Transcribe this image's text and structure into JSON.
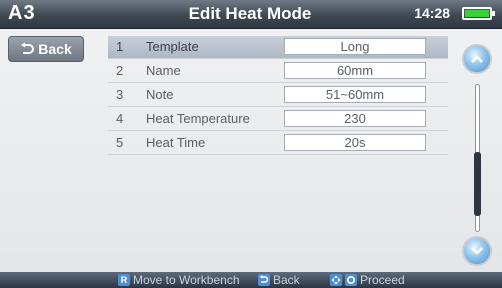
{
  "header": {
    "brand": "A3",
    "title": "Edit Heat Mode",
    "time": "14:28",
    "battery_level": 1.0
  },
  "sidebar": {
    "back_label": "Back"
  },
  "rows": [
    {
      "num": "1",
      "label": "Template",
      "value": "Long",
      "selected": true
    },
    {
      "num": "2",
      "label": "Name",
      "value": "60mm"
    },
    {
      "num": "3",
      "label": "Note",
      "value": "51~60mm"
    },
    {
      "num": "4",
      "label": "Heat Temperature",
      "value": "230"
    },
    {
      "num": "5",
      "label": "Heat Time",
      "value": "20s"
    }
  ],
  "scroll": {
    "position": 0.6
  },
  "footer": {
    "hint_move": "Move to Workbench",
    "hint_back": "Back",
    "hint_proceed": "Proceed"
  },
  "colors": {
    "header": "#3f4853",
    "selected_row": "#aeb8c5",
    "battery": "#35d23a",
    "scroll_button": "#4e90c8",
    "footer_key": "#4f8fd0"
  },
  "icons": [
    "back-arrow-icon",
    "battery-icon",
    "chevron-up-icon",
    "chevron-down-icon",
    "key-r-icon",
    "key-back-icon",
    "key-ok-icon"
  ]
}
